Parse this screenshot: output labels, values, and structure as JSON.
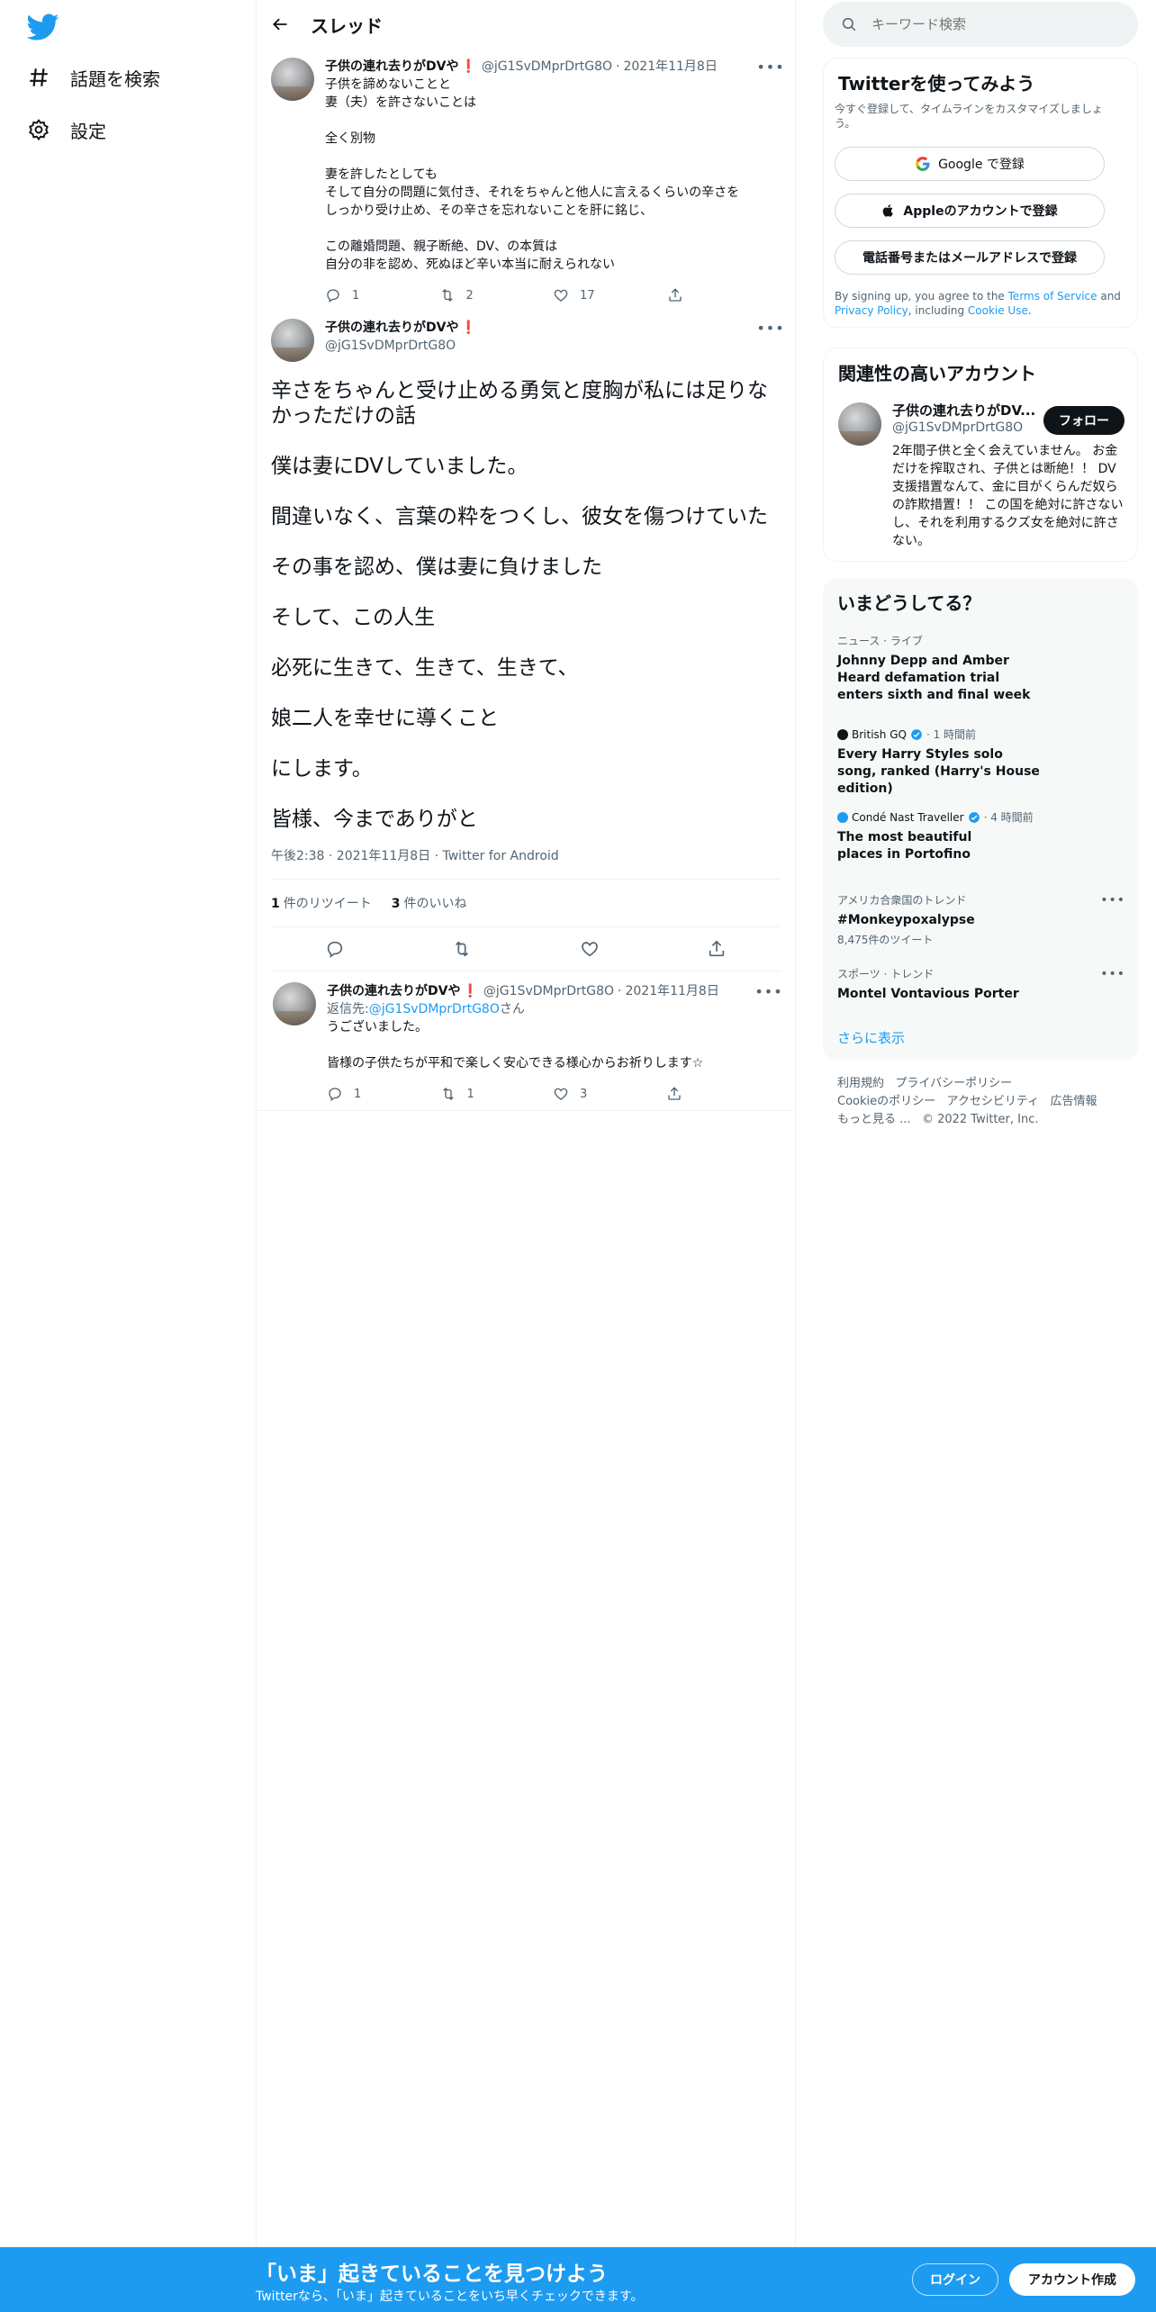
{
  "nav": {
    "explore_label": "話題を検索",
    "settings_label": "設定"
  },
  "header": {
    "title": "スレッド"
  },
  "tweets": [
    {
      "name": "子供の連れ去りがDVや",
      "flag": "❗",
      "handle": "@jG1SvDMprDrtG8O",
      "date": "2021年11月8日",
      "text": "子供を諦めないことと\n妻（夫）を許さないことは\n\n全く別物\n\n妻を許したとしても\nそして自分の問題に気付き、それをちゃんと他人に言えるくらいの辛さを\nしっかり受け止め、その辛さを忘れないことを肝に銘じ、\n\nこの離婚問題、親子断絶、DV、の本質は\n自分の非を認め、死ぬほど辛い本当に耐えられない",
      "replies": "1",
      "retweets": "2",
      "likes": "17"
    },
    {
      "name": "子供の連れ去りがDVや",
      "flag": "❗",
      "handle": "@jG1SvDMprDrtG8O",
      "paragraphs": [
        "辛さをちゃんと受け止める勇気と度胸が私には足りなかっただけの話",
        "僕は妻にDVしていました。",
        "間違いなく、言葉の粋をつくし、彼女を傷つけていた",
        "その事を認め、僕は妻に負けました",
        "そして、この人生",
        "必死に生きて、生きて、生きて、",
        "娘二人を幸せに導くこと",
        "にします。",
        "皆様、今までありがと"
      ],
      "meta": "午後2:38 · 2021年11月8日 · Twitter for Android",
      "retweet_count": "1",
      "retweet_label": "件のリツイート",
      "like_count": "3",
      "like_label": "件のいいね"
    },
    {
      "name": "子供の連れ去りがDVや",
      "flag": "❗",
      "handle": "@jG1SvDMprDrtG8O",
      "date": "2021年11月8日",
      "reply_prefix": "返信先: ",
      "reply_to": "@jG1SvDMprDrtG8O",
      "reply_suffix": "さん",
      "text": "うございました。\n\n皆様の子供たちが平和で楽しく安心できる様心からお祈りします☆",
      "replies": "1",
      "retweets": "1",
      "likes": "3"
    }
  ],
  "search": {
    "placeholder": "キーワード検索"
  },
  "signup_card": {
    "title": "Twitterを使ってみよう",
    "subtitle": "今すぐ登録して、タイムラインをカスタマイズしましょう。",
    "google": "Google で登録",
    "apple": "Appleのアカウントで登録",
    "phone": "電話番号またはメールアドレスで登録",
    "terms_pre": "By signing up, you agree to the ",
    "terms_link": "Terms of Service",
    "terms_mid": " and ",
    "privacy_link": "Privacy Policy",
    "terms_mid2": ", including ",
    "cookie_link": "Cookie Use",
    "terms_end": "."
  },
  "related": {
    "title": "関連性の高いアカウント",
    "name": "子供の連れ去りがDV...",
    "handle": "@jG1SvDMprDrtG8O",
    "follow": "フォロー",
    "bio": "2年間子供と全く会えていません。 お金だけを搾取され、子供とは断絶！！ DV支援措置なんて、金に目がくらんだ奴らの詐欺措置！！ この国を絶対に許さないし、それを利用するクズ女を絶対に許さない。"
  },
  "trends": {
    "title": "いまどうしてる？",
    "items": [
      {
        "context": "ニュース · ライブ",
        "title": "Johnny Depp and Amber Heard defamation trial enters sixth and final week"
      },
      {
        "publisher": "British GQ",
        "time": "· 1 時間前",
        "title": "Every Harry Styles solo song, ranked (Harry's House edition)"
      },
      {
        "publisher": "Condé Nast Traveller",
        "time": "· 4 時間前",
        "title": "The most beautiful places in Portofino"
      },
      {
        "context": "アメリカ合衆国のトレンド",
        "title": "#Monkeypoxalypse",
        "count": "8,475件のツイート"
      },
      {
        "context": "スポーツ · トレンド",
        "title": "Montel Vontavious Porter"
      }
    ],
    "show_more": "さらに表示"
  },
  "footer": {
    "links": [
      "利用規約",
      "プライバシーポリシー",
      "Cookieのポリシー",
      "アクセシビリティ",
      "広告情報",
      "もっと見る ..."
    ],
    "copyright": "© 2022 Twitter, Inc."
  },
  "bottom_bar": {
    "title": "「いま」起きていることを見つけよう",
    "subtitle": "Twitterなら、「いま」起きていることをいち早くチェックできます。",
    "login": "ログイン",
    "signup": "アカウント作成"
  },
  "colors": {
    "brand": "#1d9bf0",
    "text": "#0f1419",
    "secondary": "#536471"
  }
}
